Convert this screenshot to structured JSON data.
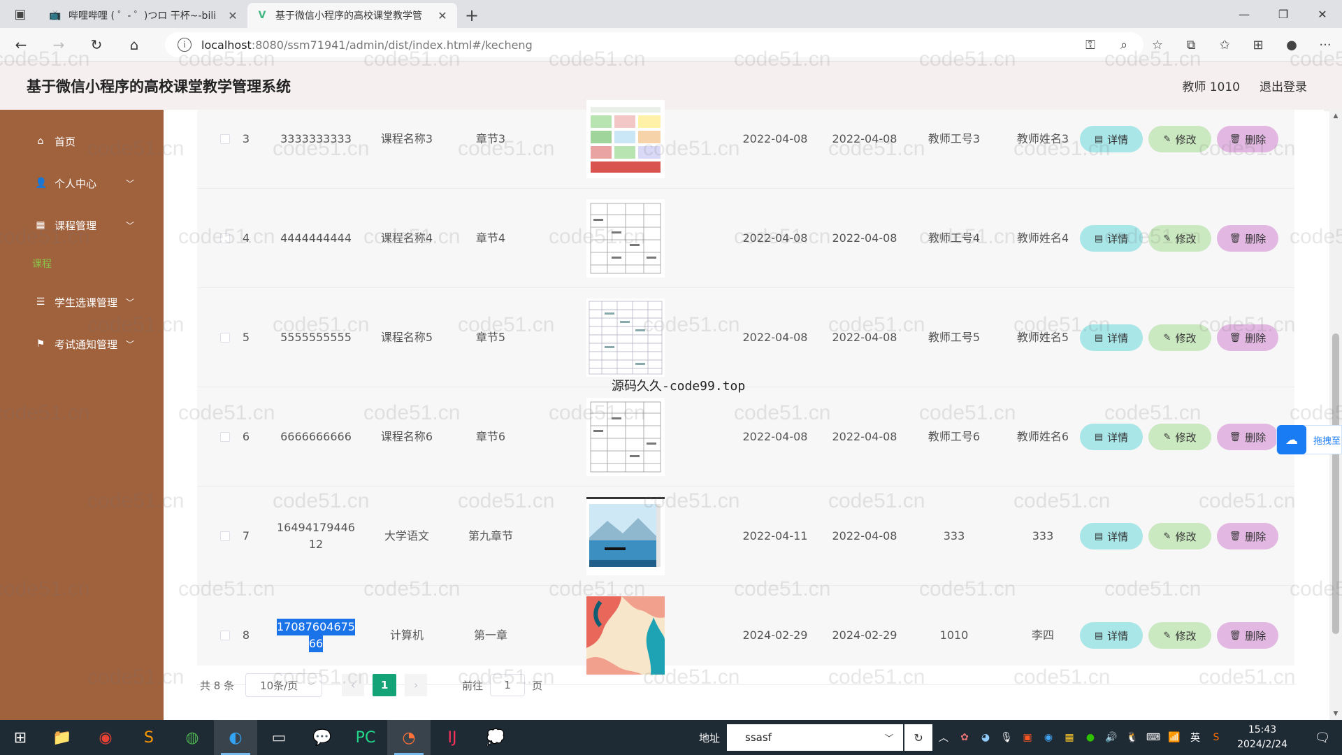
{
  "browser": {
    "tabs": [
      {
        "title": "哔哩哔哩 ( ゜- ゜)つロ 干杯~-bili",
        "active": false,
        "icon": "bilibili-icon"
      },
      {
        "title": "基于微信小程序的高校课堂教学管",
        "active": true,
        "icon": "vue-icon"
      }
    ],
    "url_host": "localhost",
    "url_rest": ":8080/ssm71941/admin/dist/index.html#/kecheng"
  },
  "app": {
    "title": "基于微信小程序的高校课堂教学管理系统",
    "user_label": "教师 1010",
    "logout_label": "退出登录"
  },
  "sidebar": {
    "items": [
      {
        "label": "首页",
        "icon": "home-icon"
      },
      {
        "label": "个人中心",
        "icon": "user-icon"
      },
      {
        "label": "课程管理",
        "icon": "grid-icon"
      },
      {
        "label": "学生选课管理",
        "icon": "list-icon"
      },
      {
        "label": "考试通知管理",
        "icon": "flag-icon"
      }
    ],
    "submenu_active": "课程"
  },
  "table": {
    "rows": [
      {
        "index": "3",
        "code": "3333333333",
        "name": "课程名称3",
        "chapter": "章节3",
        "date1": "2022-04-08",
        "date2": "2022-04-08",
        "teacher_id": "教师工号3",
        "teacher_name": "教师姓名3",
        "image": "timetable-colored"
      },
      {
        "index": "4",
        "code": "4444444444",
        "name": "课程名称4",
        "chapter": "章节4",
        "date1": "2022-04-08",
        "date2": "2022-04-08",
        "teacher_id": "教师工号4",
        "teacher_name": "教师姓名4",
        "image": "timetable-sheet"
      },
      {
        "index": "5",
        "code": "5555555555",
        "name": "课程名称5",
        "chapter": "章节5",
        "date1": "2022-04-08",
        "date2": "2022-04-08",
        "teacher_id": "教师工号5",
        "teacher_name": "教师姓名5",
        "image": "timetable-grid"
      },
      {
        "index": "6",
        "code": "6666666666",
        "name": "课程名称6",
        "chapter": "章节6",
        "date1": "2022-04-08",
        "date2": "2022-04-08",
        "teacher_id": "教师工号6",
        "teacher_name": "教师姓名6",
        "image": "timetable-sheet"
      },
      {
        "index": "7",
        "code_line1": "16494179446",
        "code_line2": "12",
        "name": "大学语文",
        "chapter": "第九章节",
        "date1": "2022-04-11",
        "date2": "2022-04-08",
        "teacher_id": "333",
        "teacher_name": "333",
        "image": "lake-landscape"
      },
      {
        "index": "8",
        "code_line1": "17087604675",
        "code_line2": "66",
        "name": "计算机",
        "chapter": "第一章",
        "date1": "2024-02-29",
        "date2": "2024-02-29",
        "teacher_id": "1010",
        "teacher_name": "李四",
        "image": "abstract-shapes"
      }
    ],
    "actions": {
      "detail": "详情",
      "edit": "修改",
      "delete": "删除"
    }
  },
  "pagination": {
    "total": "共 8 条",
    "page_size": "10条/页",
    "current_page": "1",
    "goto_label": "前往",
    "goto_value": "1",
    "page_unit": "页"
  },
  "overlay_text": "源码久久-code99.top",
  "watermark": "code51.cn",
  "float_widget": {
    "label": "拖拽至"
  },
  "taskbar": {
    "addr_label": "地址",
    "addr_value": "ssasf",
    "time": "15:43",
    "date": "2024/2/24"
  },
  "tray": {
    "input_mode": "英"
  }
}
